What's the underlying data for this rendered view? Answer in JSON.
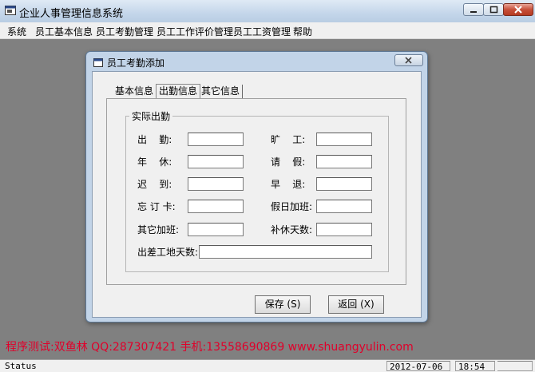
{
  "window": {
    "title": "企业人事管理信息系统"
  },
  "menu": [
    "系统",
    "员工基本信息",
    "员工考勤管理",
    "员工工作评价管理",
    "员工工资管理",
    "帮助"
  ],
  "dialog": {
    "title": "员工考勤添加",
    "tabs": [
      "基本信息",
      "出勤信息",
      "其它信息"
    ],
    "active_tab": "出勤信息",
    "group_title": "实际出勤",
    "fields": {
      "attendance": {
        "label": "出    勤:",
        "value": ""
      },
      "absent": {
        "label": "旷    工:",
        "value": ""
      },
      "annual_leave": {
        "label": "年    休:",
        "value": ""
      },
      "leave": {
        "label": "请    假:",
        "value": ""
      },
      "late": {
        "label": "迟    到:",
        "value": ""
      },
      "early_leave": {
        "label": "早    退:",
        "value": ""
      },
      "forgot_punch": {
        "label": "忘 订 卡:",
        "value": ""
      },
      "holiday_overtime": {
        "label": "假日加班:",
        "value": ""
      },
      "other_overtime": {
        "label": "其它加班:",
        "value": ""
      },
      "comp_days": {
        "label": "补休天数:",
        "value": ""
      },
      "trip_days": {
        "label": "出差工地天数:",
        "value": ""
      }
    },
    "buttons": {
      "save": "保存 (S)",
      "back": "返回 (X)"
    }
  },
  "watermark": "程序测试:双鱼林 QQ:287307421 手机:13558690869 www.shuangyulin.com",
  "status": {
    "text": "Status",
    "date": "2012-07-06",
    "time": "18:54"
  }
}
